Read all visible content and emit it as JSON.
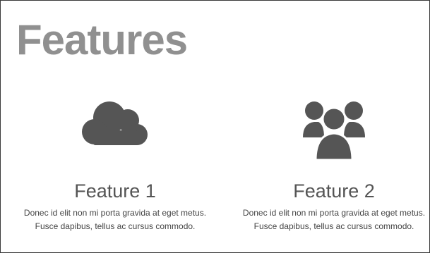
{
  "page": {
    "title": "Features"
  },
  "features": [
    {
      "icon": "cloud-icon",
      "title": "Feature 1",
      "text": "Donec id elit non mi porta gravida at eget metus. Fusce dapibus, tellus ac cursus commodo."
    },
    {
      "icon": "users-icon",
      "title": "Feature 2",
      "text": "Donec id elit non mi porta gravida at eget metus. Fusce dapibus, tellus ac cursus commodo."
    }
  ],
  "colors": {
    "title": "#909090",
    "heading": "#555555",
    "body_text": "#444444",
    "icon": "#555555"
  }
}
